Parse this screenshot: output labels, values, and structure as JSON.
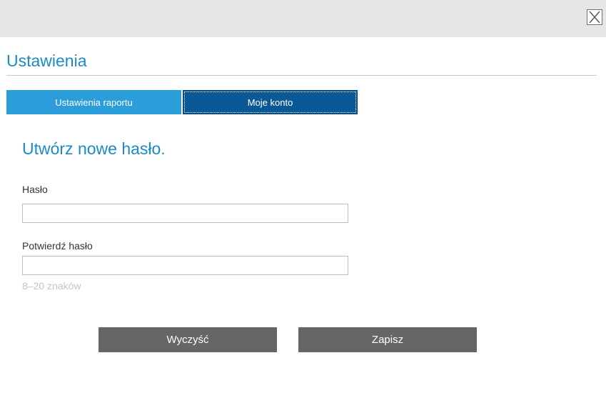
{
  "window": {
    "close_icon": "close-x-icon"
  },
  "header": {
    "title": "Ustawienia"
  },
  "tabs": [
    {
      "label": "Ustawienia raportu",
      "active": false
    },
    {
      "label": "Moje konto",
      "active": true
    }
  ],
  "form": {
    "heading": "Utwórz nowe hasło.",
    "password_label": "Hasło",
    "password_value": "",
    "confirm_label": "Potwierdź hasło",
    "confirm_value": "",
    "hint": "8–20 znaków"
  },
  "actions": {
    "clear_label": "Wyczyść",
    "save_label": "Zapisz"
  },
  "colors": {
    "accent": "#1a8bc6",
    "tab_inactive": "#2c9ddb",
    "tab_active": "#0a5896",
    "button": "#666666"
  }
}
